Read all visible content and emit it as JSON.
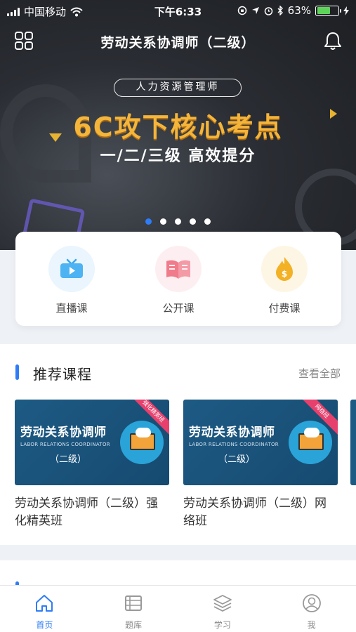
{
  "status_bar": {
    "carrier": "中国移动",
    "time": "下午6:33",
    "battery_pct": "63%",
    "battery_level": 0.63
  },
  "nav": {
    "title": "劳动关系协调师（二级）"
  },
  "banner": {
    "tag": "人力资源管理师",
    "headline": "6C攻下核心考点",
    "subline": "一/二/三级   高效提分",
    "active_slide": 1,
    "slide_count": 5
  },
  "categories": [
    {
      "label": "直播课",
      "icon": "tv-icon",
      "color": "#3aa7ef"
    },
    {
      "label": "公开课",
      "icon": "book-icon",
      "color": "#f07b8a"
    },
    {
      "label": "付费课",
      "icon": "coin-flame-icon",
      "color": "#f3b126"
    }
  ],
  "recommended": {
    "heading": "推荐课程",
    "more": "查看全部",
    "courses": [
      {
        "thumb_title": "劳动关系协调师",
        "thumb_en": "LABOR RELATIONS COORDINATOR",
        "thumb_level": "（二级）",
        "ribbon": "强化精英班",
        "title": "劳动关系协调师（二级）强化精英班"
      },
      {
        "thumb_title": "劳动关系协调师",
        "thumb_en": "LABOR RELATIONS COORDINATOR",
        "thumb_level": "（二级）",
        "ribbon": "网络班",
        "title": "劳动关系协调师（二级）网络班"
      }
    ]
  },
  "tabbar": [
    {
      "label": "首页",
      "icon": "home-icon",
      "active": true
    },
    {
      "label": "题库",
      "icon": "question-bank-icon",
      "active": false
    },
    {
      "label": "学习",
      "icon": "layers-icon",
      "active": false
    },
    {
      "label": "我",
      "icon": "profile-icon",
      "active": false
    }
  ],
  "colors": {
    "accent": "#2f7df6",
    "headline": "#f4b53a",
    "thumb_bg": "#1d5a84"
  }
}
